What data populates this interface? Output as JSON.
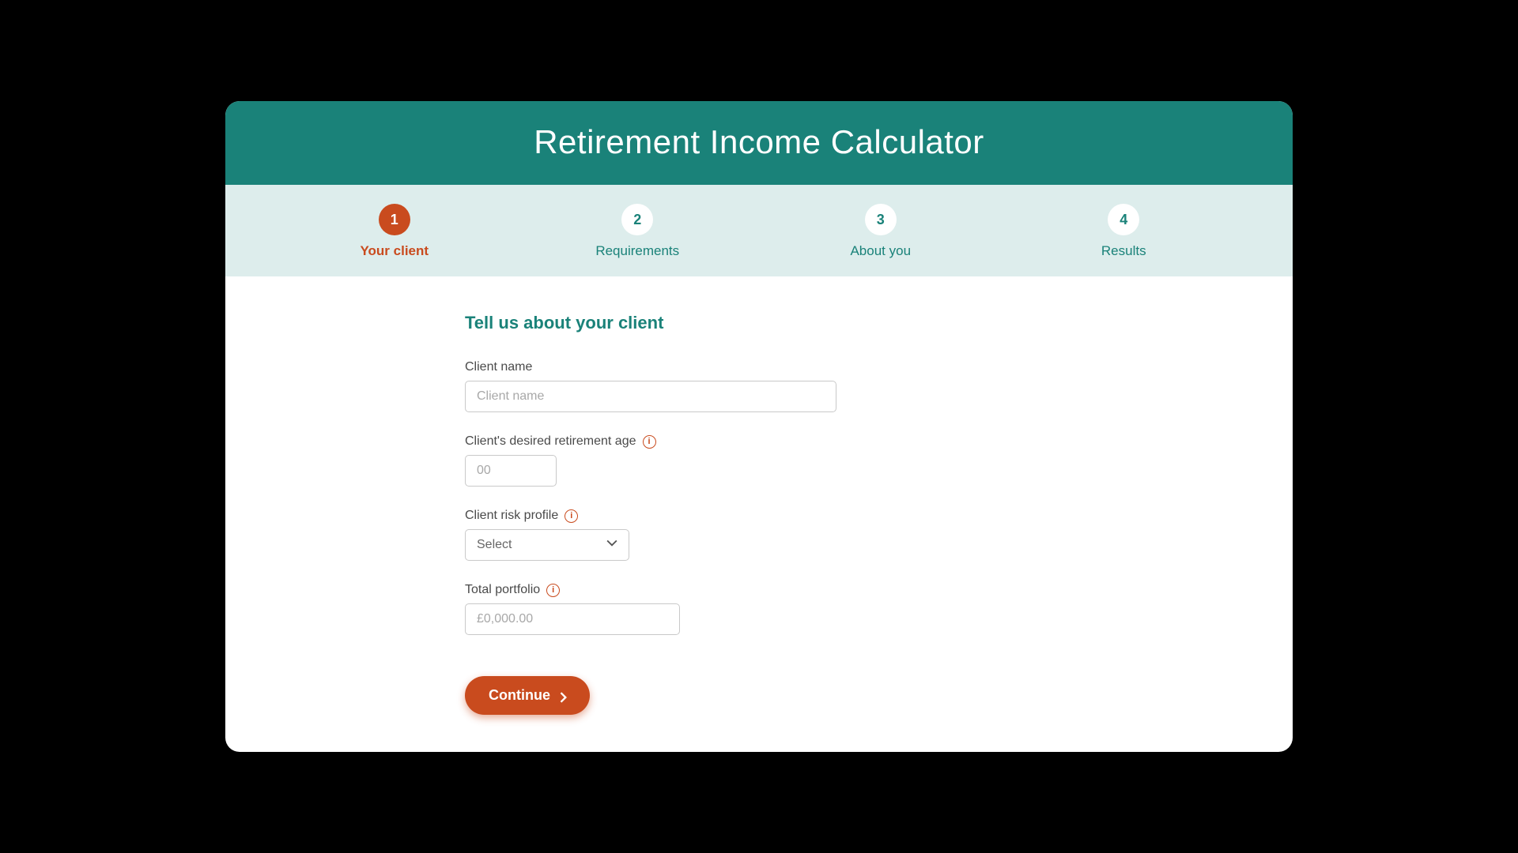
{
  "header": {
    "title": "Retirement Income Calculator"
  },
  "stepper": {
    "steps": [
      {
        "num": "1",
        "label": "Your client",
        "active": true
      },
      {
        "num": "2",
        "label": "Requirements",
        "active": false
      },
      {
        "num": "3",
        "label": "About you",
        "active": false
      },
      {
        "num": "4",
        "label": "Results",
        "active": false
      }
    ]
  },
  "form": {
    "section_title": "Tell us about your client",
    "client_name": {
      "label": "Client name",
      "placeholder": "Client name",
      "value": ""
    },
    "retirement_age": {
      "label": "Client's desired retirement age",
      "placeholder": "00",
      "value": ""
    },
    "risk_profile": {
      "label": "Client risk profile",
      "selected": "Select"
    },
    "total_portfolio": {
      "label": "Total portfolio",
      "placeholder": "£0,000.00",
      "value": ""
    },
    "continue_label": "Continue"
  }
}
